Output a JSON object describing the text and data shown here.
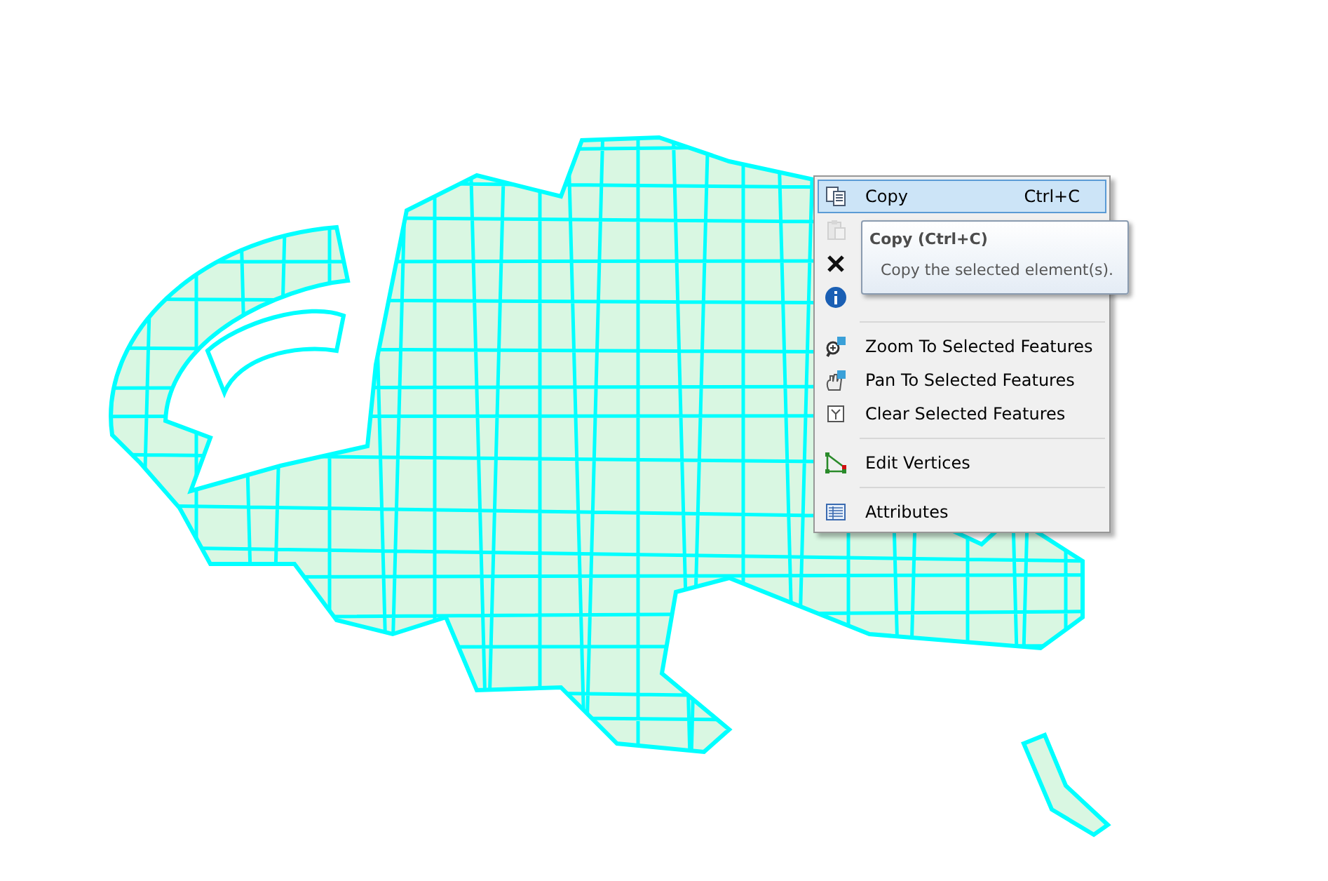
{
  "context_menu": {
    "items": [
      {
        "kind": "item",
        "label": "Copy",
        "shortcut": "Ctrl+C",
        "selected": true,
        "disabled": false
      },
      {
        "kind": "item",
        "selected": false,
        "disabled": true
      },
      {
        "kind": "item",
        "selected": false,
        "disabled": false
      },
      {
        "kind": "item",
        "selected": false,
        "disabled": false
      },
      {
        "kind": "separator"
      },
      {
        "kind": "item",
        "label": "Zoom To Selected Features",
        "selected": false,
        "disabled": false
      },
      {
        "kind": "item",
        "label": "Pan To Selected Features",
        "selected": false,
        "disabled": false
      },
      {
        "kind": "item",
        "label": "Clear Selected Features",
        "selected": false,
        "disabled": false
      },
      {
        "kind": "separator"
      },
      {
        "kind": "item",
        "label": "Edit Vertices",
        "selected": false,
        "disabled": false
      },
      {
        "kind": "separator"
      },
      {
        "kind": "item",
        "label": "Attributes",
        "selected": false,
        "disabled": false
      }
    ]
  },
  "tooltip": {
    "title": "Copy (Ctrl+C)",
    "text": "Copy the selected element(s)."
  }
}
